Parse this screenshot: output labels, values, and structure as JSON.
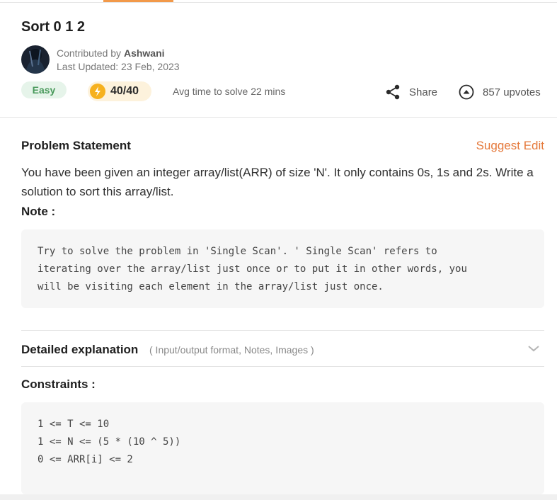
{
  "problem": {
    "title": "Sort 0 1 2",
    "contributed_by_prefix": "Contributed by",
    "author": "Ashwani",
    "last_updated": "Last Updated: 23 Feb, 2023",
    "difficulty": "Easy",
    "score": "40/40",
    "avg_time": "Avg time to solve 22 mins",
    "share_label": "Share",
    "upvotes_label": "857 upvotes"
  },
  "statement": {
    "heading": "Problem Statement",
    "suggest_edit": "Suggest Edit",
    "text": "You have been given an integer array/list(ARR) of size 'N'. It only contains 0s, 1s and 2s. Write a solution to sort this array/list.",
    "note_label": "Note :",
    "note_code": "Try to solve the problem in 'Single Scan'. ' Single Scan' refers to\niterating over the array/list just once or to put it in other words, you\nwill be visiting each element in the array/list just once."
  },
  "detailed": {
    "label": "Detailed explanation",
    "sub": "( Input/output format, Notes, Images )"
  },
  "constraints": {
    "label": "Constraints :",
    "code": "1 <= T <= 10\n1 <= N <= (5 * (10 ^ 5))\n0 <= ARR[i] <= 2"
  },
  "colors": {
    "accent": "#e5793b",
    "easy_bg": "#e6f4ea",
    "easy_text": "#4a9a5c",
    "score_bg": "#fdf2dc",
    "bolt": "#f6b11e"
  },
  "icons": [
    "bolt-icon",
    "share-icon",
    "upvote-icon",
    "chevron-down-icon"
  ]
}
